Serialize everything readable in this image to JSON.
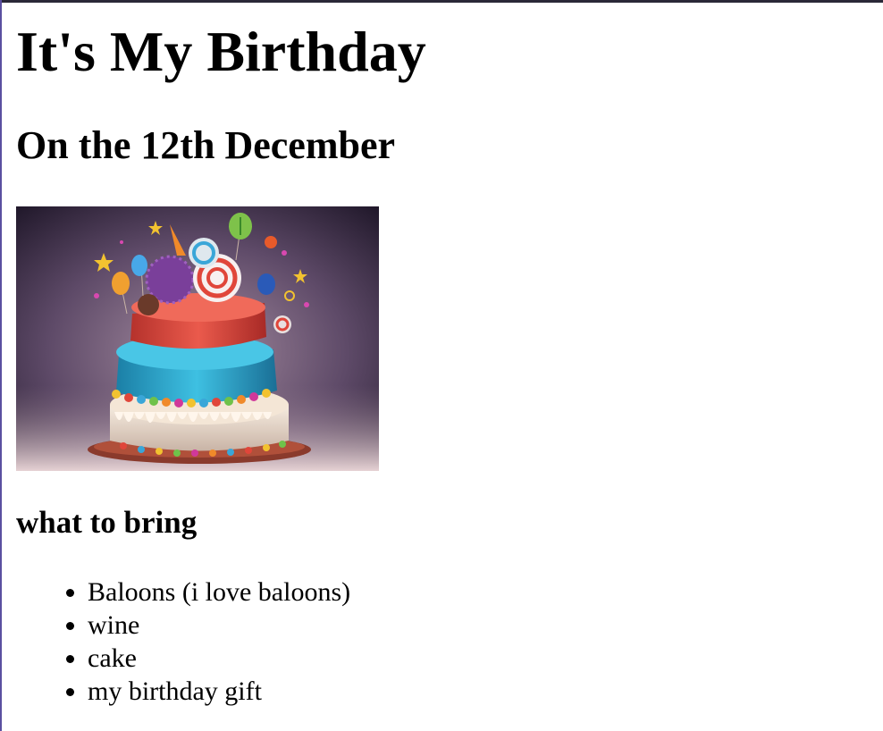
{
  "page": {
    "title": "It's My Birthday",
    "subtitle": "On the 12th December"
  },
  "image": {
    "subject": "birthday-cake",
    "colors": {
      "bg_dark": "#241a30",
      "bg_light": "#b09aa8",
      "frosting_red": "#d8453c",
      "frosting_blue": "#2a9fc4",
      "frosting_cream": "#efe2d0"
    }
  },
  "section": {
    "heading": "what to bring",
    "items": [
      {
        "label": "Baloons (i love baloons)"
      },
      {
        "label": "wine"
      },
      {
        "label": "cake"
      },
      {
        "label": "my birthday gift"
      }
    ]
  }
}
